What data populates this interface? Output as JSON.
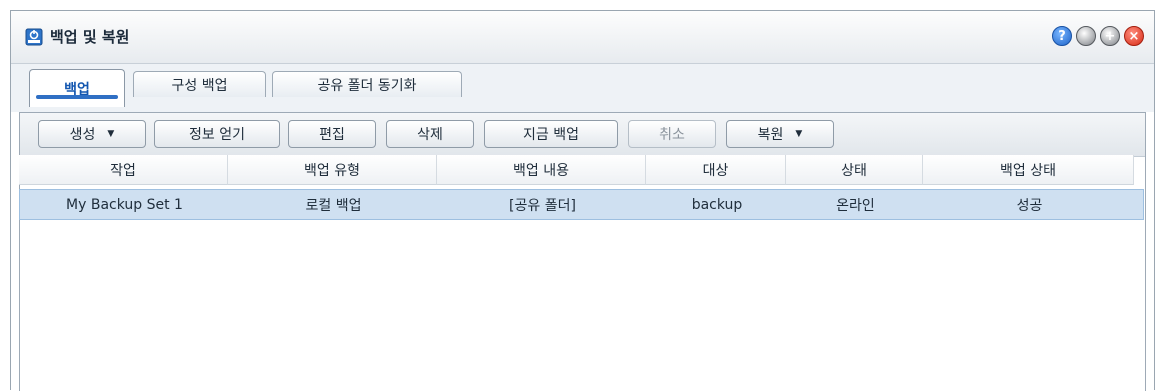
{
  "window": {
    "title": "백업 및 복원",
    "icon": "backup-app-icon"
  },
  "window_controls": [
    {
      "name": "help-icon",
      "glyph": "?"
    },
    {
      "name": "minimize-icon",
      "glyph": ""
    },
    {
      "name": "maximize-icon",
      "glyph": "+"
    },
    {
      "name": "close-icon",
      "glyph": "×"
    }
  ],
  "tabs": [
    {
      "label": "백업",
      "active": true
    },
    {
      "label": "구성 백업",
      "active": false
    },
    {
      "label": "공유 폴더 동기화",
      "active": false
    }
  ],
  "toolbar": {
    "create": "생성",
    "info": "정보 얻기",
    "edit": "편집",
    "delete": "삭제",
    "backup_now": "지금 백업",
    "cancel": "취소",
    "restore": "복원"
  },
  "table": {
    "headers": [
      "작업",
      "백업 유형",
      "백업 내용",
      "대상",
      "상태",
      "백업 상태"
    ],
    "rows": [
      [
        "My Backup Set 1",
        "로컬 백업",
        "[공유 폴더]",
        "backup",
        "온라인",
        "성공"
      ]
    ]
  },
  "colors": {
    "accent": "#2f6fc4",
    "selected_row": "#cfe0f1"
  }
}
